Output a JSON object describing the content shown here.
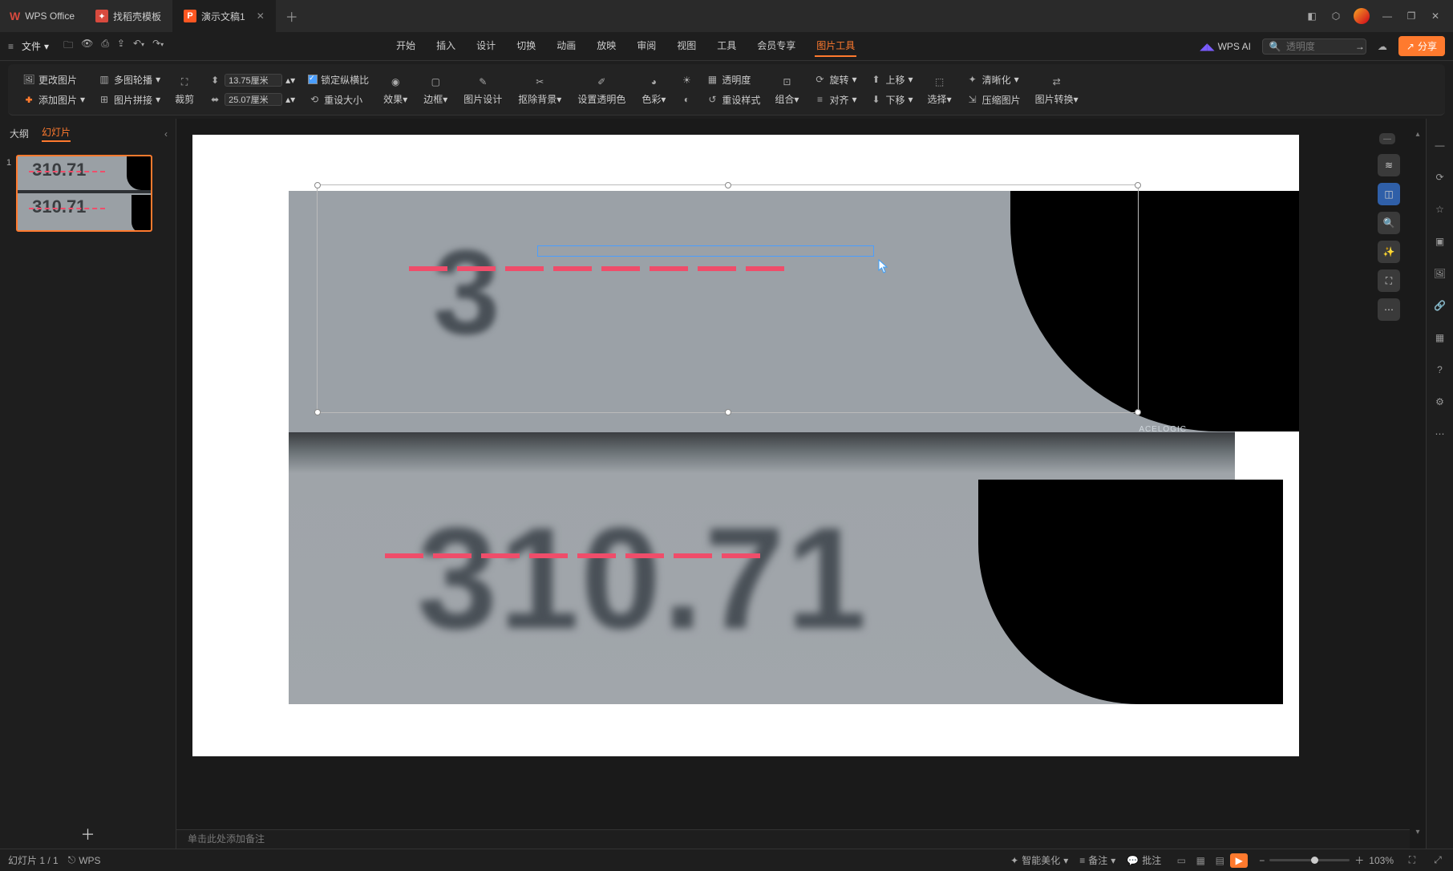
{
  "app_name": "WPS Office",
  "tabs": {
    "template": {
      "label": "找稻壳模板",
      "icon_color": "#d84a3e"
    },
    "doc": {
      "label": "演示文稿1",
      "icon_letter": "P",
      "icon_bg": "#ff5722"
    }
  },
  "file_menu": "文件",
  "menu_tabs": {
    "start": "开始",
    "insert": "插入",
    "design": "设计",
    "transition": "切换",
    "animation": "动画",
    "slideshow": "放映",
    "review": "审阅",
    "view": "视图",
    "tools": "工具",
    "member": "会员专享",
    "picture_tools": "图片工具"
  },
  "wps_ai": "WPS AI",
  "search_placeholder": "透明度",
  "share": "分享",
  "ribbon": {
    "change_pic": "更改图片",
    "multi_outline": "多图轮播",
    "add_pic": "添加图片",
    "pic_merge": "图片拼接",
    "crop": "裁剪",
    "height": "13.75厘米",
    "width": "25.07厘米",
    "lock_ratio": "锁定纵横比",
    "reset_size": "重设大小",
    "effect": "效果",
    "border": "边框",
    "pic_design": "图片设计",
    "remove_bg": "抠除背景",
    "set_trans": "设置透明色",
    "color": "色彩",
    "transparency": "透明度",
    "reset_style": "重设样式",
    "group": "组合",
    "rotate": "旋转",
    "align": "对齐",
    "move_up": "上移",
    "move_down": "下移",
    "select": "选择",
    "clarity": "清晰化",
    "compress": "压缩图片",
    "convert": "图片转换"
  },
  "left_pane": {
    "outline": "大纲",
    "slides": "幻灯片",
    "slide_num": "1"
  },
  "slide_image": {
    "top_partial": "3",
    "bottom_text": "310.71",
    "side_label": "ACELOGIC"
  },
  "notes_hint": "单击此处添加备注",
  "status": {
    "slide_pos": "幻灯片 1 / 1",
    "wps_link": "WPS",
    "beautify": "智能美化",
    "notes": "备注",
    "comments": "批注",
    "zoom": "103%"
  }
}
